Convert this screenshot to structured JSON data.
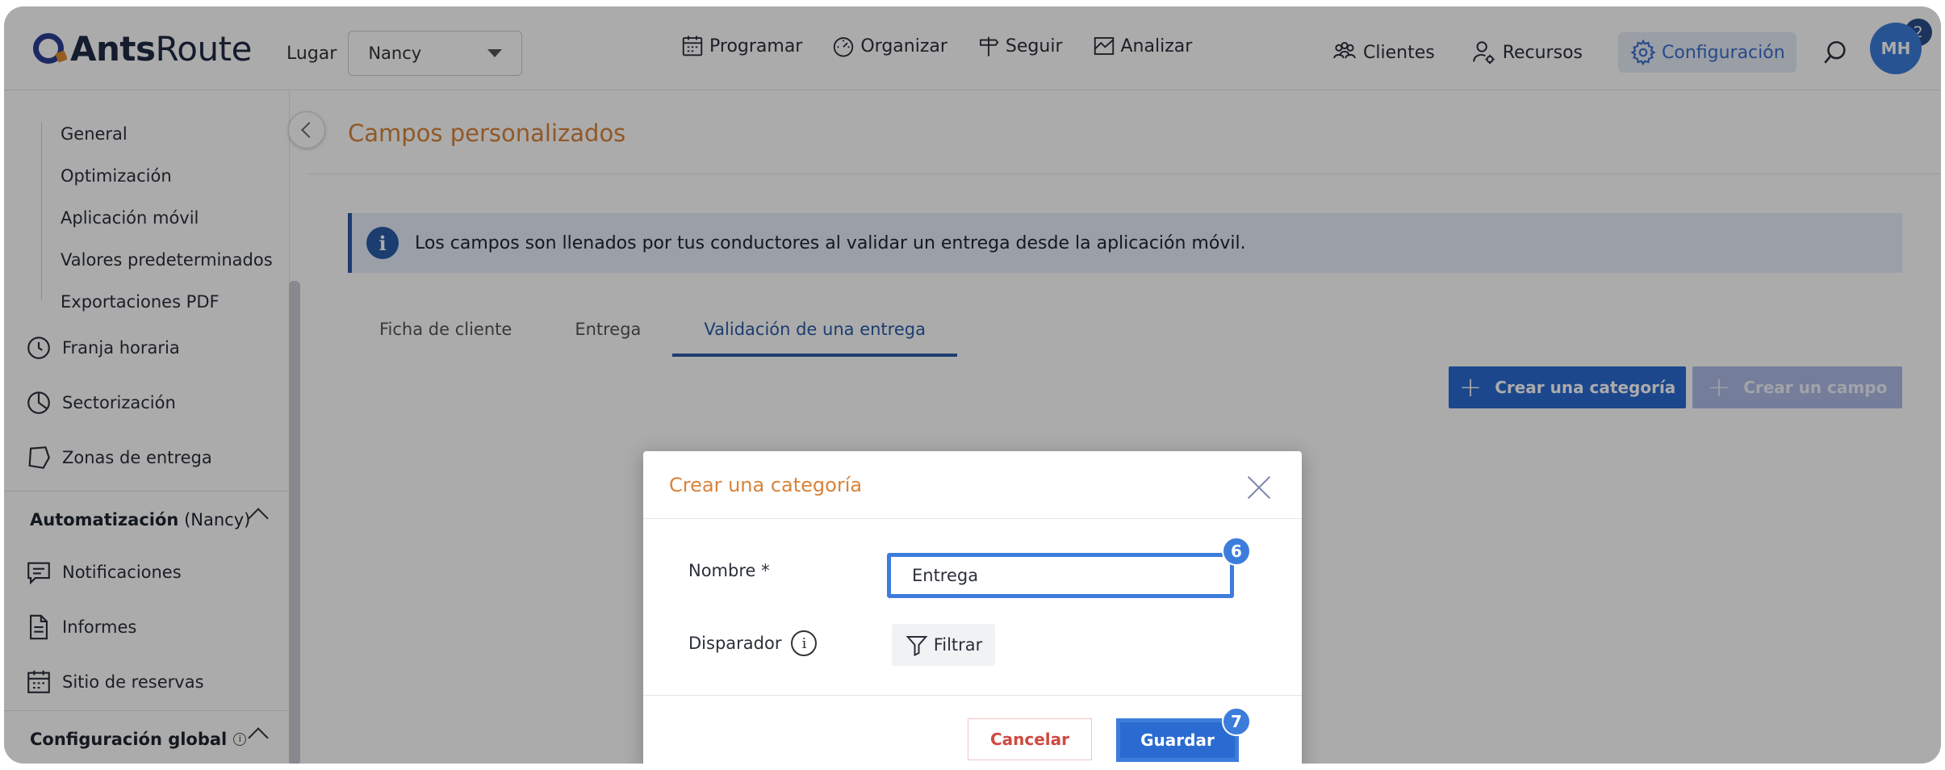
{
  "app": {
    "logo_bold": "Ants",
    "logo_light": "Route"
  },
  "header": {
    "lugar_label": "Lugar",
    "lugar_value": "Nancy",
    "nav": [
      {
        "label": "Programar",
        "icon": "calendar-icon"
      },
      {
        "label": "Organizar",
        "icon": "speedometer-icon"
      },
      {
        "label": "Seguir",
        "icon": "signpost-icon"
      },
      {
        "label": "Analizar",
        "icon": "chart-icon"
      }
    ],
    "right_nav": [
      {
        "label": "Clientes",
        "icon": "people-icon"
      },
      {
        "label": "Recursos",
        "icon": "user-gear-icon"
      },
      {
        "label": "Configuración",
        "icon": "gear-icon",
        "active": true
      }
    ],
    "notifications_count": "2",
    "avatar_initials": "MH"
  },
  "sidebar": {
    "sub_items": [
      "General",
      "Optimización",
      "Aplicación móvil",
      "Valores predeterminados",
      "Exportaciones PDF"
    ],
    "items": [
      {
        "label": "Franja horaria",
        "icon": "clock-icon"
      },
      {
        "label": "Sectorización",
        "icon": "pie-icon"
      },
      {
        "label": "Zonas de entrega",
        "icon": "polygon-icon"
      }
    ],
    "section_auto_bold": "Automatización",
    "section_auto_rest": " (Nancy)",
    "auto_items": [
      {
        "label": "Notificaciones",
        "icon": "message-icon"
      },
      {
        "label": "Informes",
        "icon": "document-icon"
      },
      {
        "label": "Sitio de reservas",
        "icon": "calendar-grid-icon"
      }
    ],
    "section_global": "Configuración global"
  },
  "main": {
    "title": "Campos personalizados",
    "info_text": "Los campos son llenados por tus conductores al validar un entrega desde la aplicación móvil.",
    "tabs": [
      "Ficha de cliente",
      "Entrega",
      "Validación de una entrega"
    ],
    "active_tab": "Validación de una entrega",
    "create_category_label": "Crear una categoría",
    "create_field_label": "Crear un campo"
  },
  "modal": {
    "title": "Crear una categoría",
    "name_label": "Nombre *",
    "name_value": "Entrega",
    "trigger_label": "Disparador",
    "filter_label": "Filtrar",
    "cancel_label": "Cancelar",
    "save_label": "Guardar",
    "step_name": "6",
    "step_save": "7"
  },
  "colors": {
    "brand_orange": "#d9833a",
    "primary_blue": "#2a6bd1",
    "highlight_blue": "#3c7ddc"
  }
}
